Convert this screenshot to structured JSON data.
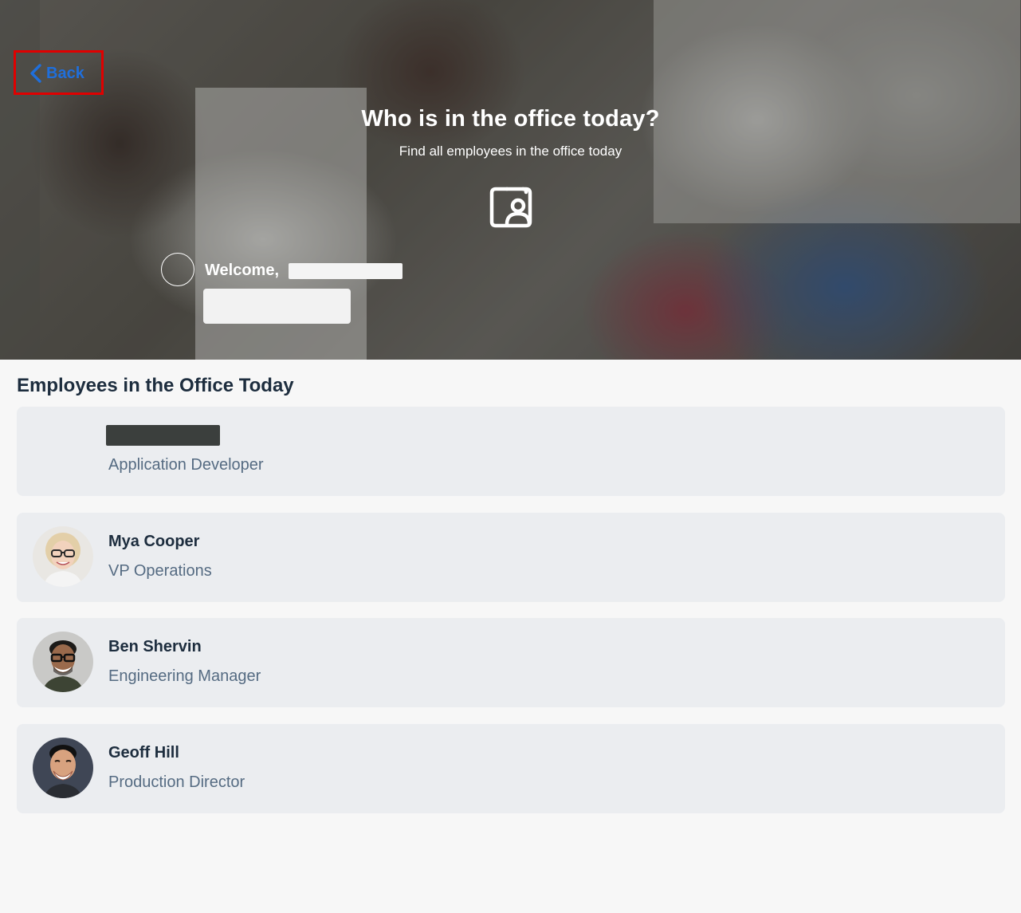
{
  "header": {
    "back_label": "Back",
    "title": "Who is in the office today?",
    "subtitle": "Find all employees in the office today",
    "welcome_label": "Welcome,",
    "icon": "contact-card-icon"
  },
  "section": {
    "title": "Employees in the Office Today"
  },
  "employees": [
    {
      "name": "",
      "role": "Application Developer",
      "avatar": "none"
    },
    {
      "name": "Mya Cooper",
      "role": "VP Operations",
      "avatar": "photo-woman-glasses"
    },
    {
      "name": "Ben Shervin",
      "role": "Engineering Manager",
      "avatar": "photo-man-glasses"
    },
    {
      "name": "Geoff Hill",
      "role": "Production Director",
      "avatar": "photo-man-smiling"
    }
  ],
  "colors": {
    "accent": "#1f6fdc",
    "highlight": "#e00000",
    "title_text": "#1d2d3e",
    "secondary_text": "#556b82",
    "card_bg": "#ebedf0"
  }
}
